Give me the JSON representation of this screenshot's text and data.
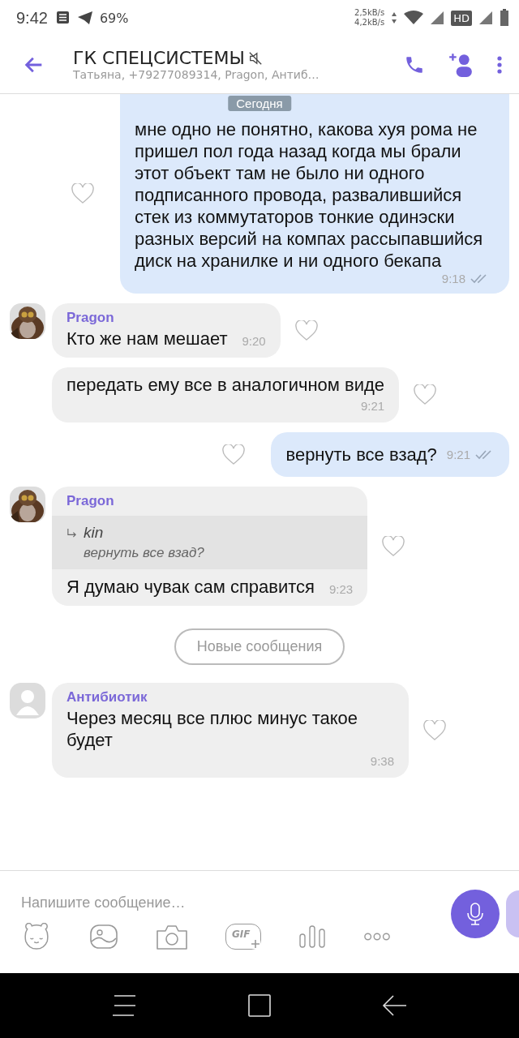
{
  "status_bar": {
    "time": "9:42",
    "battery_percent": "69%",
    "upload_speed": "2,5kB/s",
    "download_speed": "4,2kB/s",
    "hd_badge": "HD"
  },
  "header": {
    "title": "ГК СПЕЦСИСТЕМЫ",
    "muted": true,
    "subtitle": "Татьяна, +79277089314, Pragon, Антиб…"
  },
  "date_chip": "Сегодня",
  "messages": [
    {
      "kind": "outgoing",
      "text": "мне одно не понятно, какова хуя рома не пришел пол года назад когда мы брали этот объект там не было ни одного подписанного провода, развалившийся стек из коммутаторов тонкие одинэски разных версий на компах рассыпавшийся диск на хранилке и ни одного бекапа",
      "time": "9:18",
      "read": true
    },
    {
      "kind": "incoming",
      "sender": "Pragon",
      "text": "Кто же нам мешает",
      "time": "9:20"
    },
    {
      "kind": "incoming",
      "text": "передать ему все в аналогичном виде",
      "time": "9:21"
    },
    {
      "kind": "outgoing",
      "text": "вернуть все взад?",
      "time": "9:21",
      "read": true
    },
    {
      "kind": "incoming",
      "sender": "Pragon",
      "reply": {
        "author": "kin",
        "text": "вернуть все взад?"
      },
      "text": "Я думаю чувак сам справится",
      "time": "9:23"
    },
    {
      "kind": "divider",
      "text": "Новые сообщения"
    },
    {
      "kind": "incoming",
      "sender": "Антибиотик",
      "avatar": {
        "kind": "generic"
      },
      "text": "Через месяц все плюс минус такое будет",
      "time": "9:38"
    }
  ],
  "composer": {
    "placeholder": "Напишите сообщение…",
    "gif_label": "GIF"
  }
}
